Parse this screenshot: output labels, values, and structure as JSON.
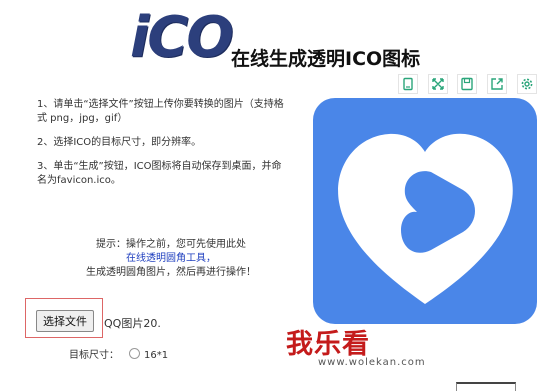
{
  "header": {
    "logo": "iCO",
    "title": "在线生成透明ICO图标"
  },
  "instructions": {
    "step1": "1、请单击“选择文件”按钮上传你要转换的图片（支持格式 png，jpg，gif）",
    "step2": "2、选择ICO的目标尺寸，即分辨率。",
    "step3": "3、单击“生成”按钮，ICO图标将自动保存到桌面，并命名为favicon.ico。"
  },
  "tip": {
    "prefix": "提示：操作之前，您可先使用此处",
    "link": "在线透明圆角工具",
    "suffix": "，",
    "line3": "生成透明圆角图片，然后再进行操作！"
  },
  "upload": {
    "button_label": "选择文件",
    "file_name": "QQ图片20."
  },
  "size": {
    "label": "目标尺寸：",
    "option": "16*1"
  },
  "toolbar": {
    "icons": [
      "copy-icon",
      "expand-icon",
      "save-icon",
      "share-icon",
      "settings-icon"
    ],
    "color": "#2aa57a"
  },
  "preview": {
    "background": "#4a86e8"
  },
  "watermark": {
    "text": "我乐看",
    "url": "www.wolekan.com"
  }
}
